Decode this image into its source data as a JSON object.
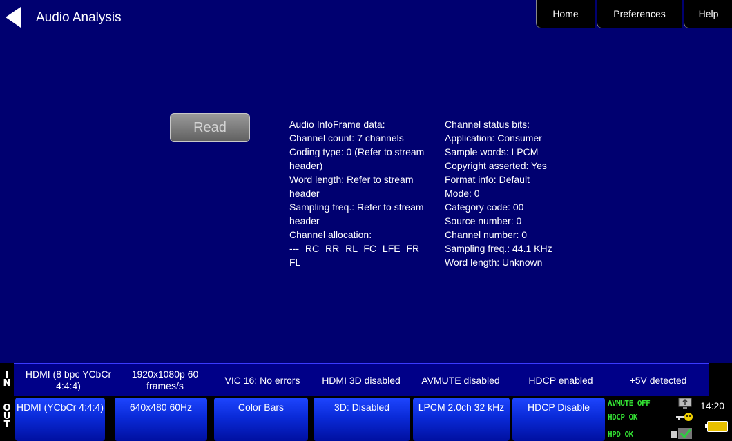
{
  "header": {
    "title": "Audio Analysis",
    "nav": {
      "home": "Home",
      "preferences": "Preferences",
      "help": "Help"
    }
  },
  "main": {
    "read_label": "Read",
    "audio_infoframe": [
      "Audio InfoFrame data:",
      "Channel count: 7 channels",
      "Coding type: 0 (Refer to stream header)",
      "Word length: Refer to stream header",
      "Sampling freq.: Refer to stream header",
      "Channel allocation:",
      "--- RC RR RL FC LFE FR FL"
    ],
    "channel_status": [
      "Channel status bits:",
      "Application: Consumer",
      "Sample words: LPCM",
      "Copyright asserted: Yes",
      "Format info: Default",
      "Mode: 0",
      "Category code: 00",
      "Source number: 0",
      "Channel number: 0",
      "Sampling freq.: 44.1 KHz",
      "Word length: Unknown"
    ]
  },
  "in_bar": {
    "label": "IN",
    "cells": [
      "HDMI (8 bpc YCbCr 4:4:4)",
      "1920x1080p 60 frames/s",
      "VIC 16: No errors",
      "HDMI 3D disabled",
      "AVMUTE disabled",
      "HDCP enabled",
      "+5V detected"
    ]
  },
  "out_bar": {
    "label": "OUT",
    "buttons": [
      "HDMI (YCbCr 4:4:4)",
      "640x480 60Hz",
      "Color Bars",
      "3D: Disabled",
      "LPCM 2.0ch 32 kHz",
      "HDCP Disable"
    ],
    "status": {
      "avmute": "AVMUTE OFF",
      "hdcp": "HDCP OK",
      "hpd": "HPD OK"
    },
    "time": "14:20"
  },
  "icons": [
    "back-arrow-icon",
    "monitor-icon",
    "key-icon",
    "plug-check-icon",
    "battery-icon"
  ],
  "colors": {
    "background": "#000070",
    "bar_blue": "#0a2ad8",
    "status_green": "#33e033"
  }
}
